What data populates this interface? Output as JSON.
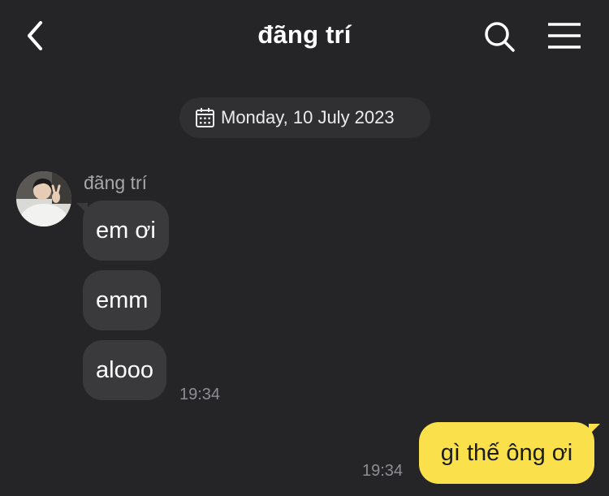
{
  "header": {
    "title": "đãng trí",
    "back_icon": "chevron-left-icon",
    "search_icon": "search-icon",
    "menu_icon": "hamburger-menu-icon"
  },
  "date_separator": {
    "icon": "calendar-icon",
    "text": "Monday, 10 July 2023"
  },
  "incoming": {
    "sender_name": "đãng trí",
    "avatar_icon": "avatar",
    "messages": [
      "em ơi",
      "emm",
      "alooo"
    ],
    "time": "19:34"
  },
  "outgoing": {
    "message": "gì thế ông ơi",
    "time": "19:34"
  },
  "colors": {
    "background": "#252527",
    "incoming_bubble": "#3a3a3c",
    "outgoing_bubble": "#fae04b",
    "date_pill": "#303033",
    "timestamp": "#8e8e92"
  }
}
